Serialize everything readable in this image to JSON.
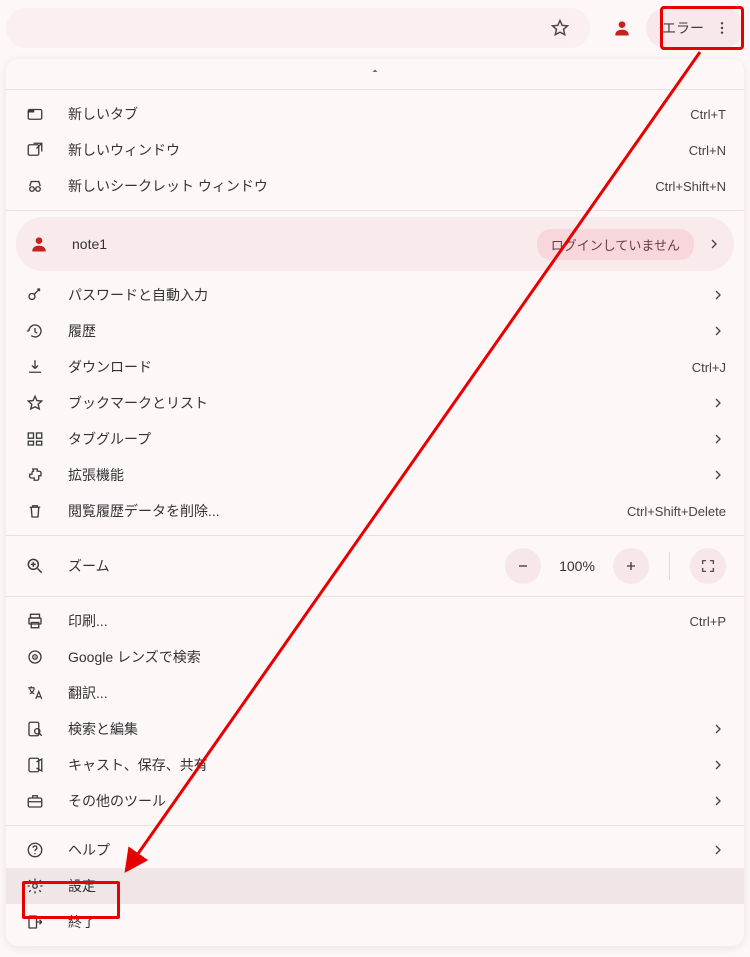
{
  "toolbar": {
    "error_label": "エラー"
  },
  "profile": {
    "name": "note1",
    "status": "ログインしていません"
  },
  "section_tabs": [
    {
      "label": "新しいタブ",
      "shortcut": "Ctrl+T",
      "icon": "new-tab"
    },
    {
      "label": "新しいウィンドウ",
      "shortcut": "Ctrl+N",
      "icon": "new-window"
    },
    {
      "label": "新しいシークレット ウィンドウ",
      "shortcut": "Ctrl+Shift+N",
      "icon": "incognito"
    }
  ],
  "section_main": [
    {
      "label": "パスワードと自動入力",
      "icon": "key",
      "chev": true
    },
    {
      "label": "履歴",
      "icon": "history",
      "chev": true
    },
    {
      "label": "ダウンロード",
      "icon": "download",
      "shortcut": "Ctrl+J"
    },
    {
      "label": "ブックマークとリスト",
      "icon": "star",
      "chev": true
    },
    {
      "label": "タブグループ",
      "icon": "tab-groups",
      "chev": true
    },
    {
      "label": "拡張機能",
      "icon": "extensions",
      "chev": true
    },
    {
      "label": "閲覧履歴データを削除...",
      "icon": "trash",
      "shortcut": "Ctrl+Shift+Delete"
    }
  ],
  "zoom": {
    "label": "ズーム",
    "value": "100%"
  },
  "section_tools": [
    {
      "label": "印刷...",
      "icon": "print",
      "shortcut": "Ctrl+P"
    },
    {
      "label": "Google レンズで検索",
      "icon": "lens"
    },
    {
      "label": "翻訳...",
      "icon": "translate"
    },
    {
      "label": "検索と編集",
      "icon": "find",
      "chev": true
    },
    {
      "label": "キャスト、保存、共有",
      "icon": "cast",
      "chev": true
    },
    {
      "label": "その他のツール",
      "icon": "briefcase",
      "chev": true
    }
  ],
  "section_footer": [
    {
      "label": "ヘルプ",
      "icon": "help",
      "chev": true
    },
    {
      "label": "設定",
      "icon": "gear",
      "highlight": true
    },
    {
      "label": "終了",
      "icon": "exit"
    }
  ]
}
